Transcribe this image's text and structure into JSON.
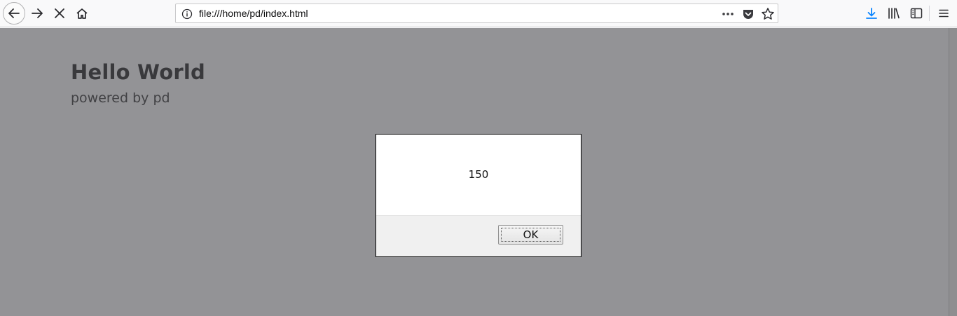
{
  "browser": {
    "url": "file:///home/pd/index.html",
    "icons": {
      "back": "back-arrow-icon",
      "forward": "forward-arrow-icon",
      "stop": "stop-icon",
      "home": "home-icon",
      "info": "info-icon",
      "more": "more-dots-icon",
      "pocket": "pocket-icon",
      "bookmark": "star-icon",
      "downloads": "download-icon",
      "library": "library-icon",
      "sidebar": "sidebar-icon",
      "menu": "hamburger-menu-icon"
    },
    "accent_color": "#0a84ff"
  },
  "page": {
    "title": "Hello World",
    "subtitle": "powered by pd"
  },
  "dialog": {
    "message": "150",
    "ok_label": "OK"
  }
}
